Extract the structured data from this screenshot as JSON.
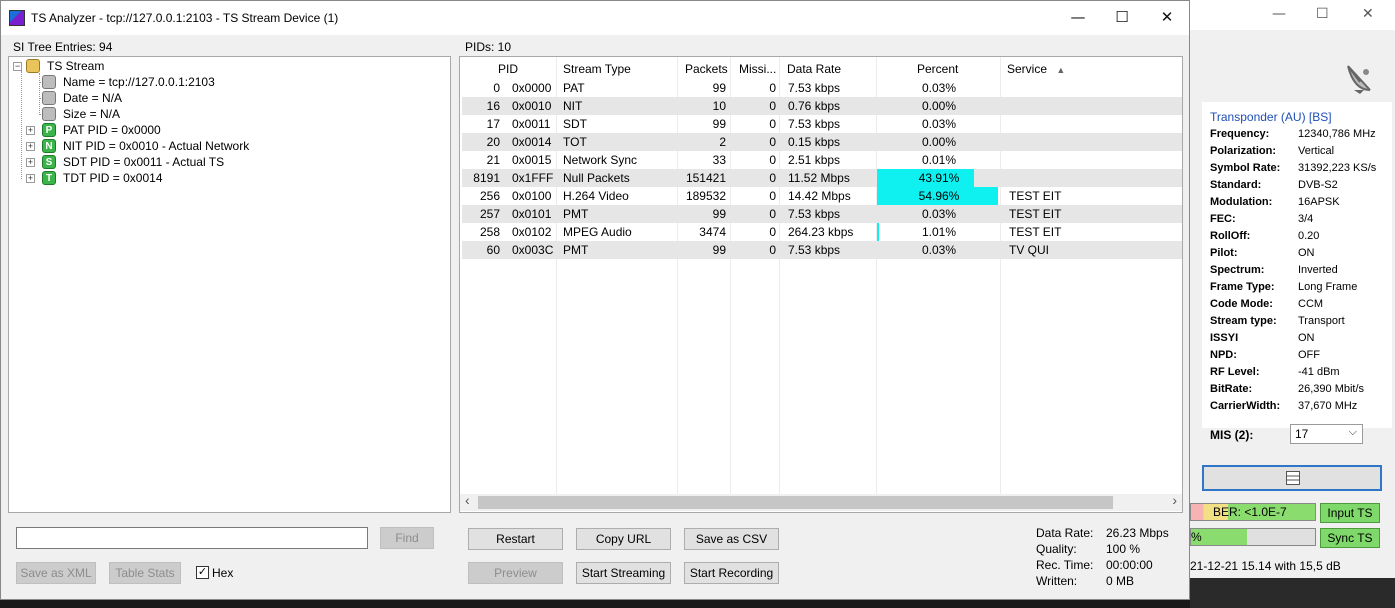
{
  "window": {
    "title": "TS Analyzer - tcp://127.0.0.1:2103 - TS Stream Device (1)",
    "minimize": "—",
    "maximize": "☐",
    "close": "✕"
  },
  "si_tree": {
    "header": "SI Tree Entries: 94",
    "root": "TS Stream",
    "items": [
      {
        "label": "Name = tcp://127.0.0.1:2103",
        "icon": "leaf-icon",
        "badge": ""
      },
      {
        "label": "Date = N/A",
        "icon": "leaf-icon",
        "badge": ""
      },
      {
        "label": "Size = N/A",
        "icon": "leaf-icon",
        "badge": ""
      },
      {
        "label": "PAT PID = 0x0000",
        "icon": "pat-table-icon",
        "badge": "P"
      },
      {
        "label": "NIT PID = 0x0010 - Actual Network",
        "icon": "nit-table-icon",
        "badge": "N"
      },
      {
        "label": "SDT PID = 0x0011 - Actual TS",
        "icon": "sdt-table-icon",
        "badge": "S"
      },
      {
        "label": "TDT PID = 0x0014",
        "icon": "tdt-table-icon",
        "badge": "T"
      }
    ]
  },
  "find": {
    "value": "",
    "button": "Find",
    "save_xml": "Save as XML",
    "table_stats": "Table Stats",
    "hex_label": "Hex",
    "hex_check": "✓"
  },
  "pids": {
    "header": "PIDs: 10",
    "columns": {
      "pid": "PID",
      "stream_type": "Stream Type",
      "packets": "Packets",
      "missing": "Missi...",
      "data_rate": "Data Rate",
      "percent": "Percent",
      "service": "Service",
      "sort_indicator": "▲"
    },
    "rows": [
      {
        "pid": "0",
        "hex": "0x0000",
        "type": "PAT",
        "packets": "99",
        "missing": "0",
        "rate": "7.53 kbps",
        "percent": "0.03%",
        "bar": 0.0003,
        "service": ""
      },
      {
        "pid": "16",
        "hex": "0x0010",
        "type": "NIT",
        "packets": "10",
        "missing": "0",
        "rate": "0.76 kbps",
        "percent": "0.00%",
        "bar": 0,
        "service": ""
      },
      {
        "pid": "17",
        "hex": "0x0011",
        "type": "SDT",
        "packets": "99",
        "missing": "0",
        "rate": "7.53 kbps",
        "percent": "0.03%",
        "bar": 0.0003,
        "service": ""
      },
      {
        "pid": "20",
        "hex": "0x0014",
        "type": "TOT",
        "packets": "2",
        "missing": "0",
        "rate": "0.15 kbps",
        "percent": "0.00%",
        "bar": 0,
        "service": ""
      },
      {
        "pid": "21",
        "hex": "0x0015",
        "type": "Network Sync",
        "packets": "33",
        "missing": "0",
        "rate": "2.51 kbps",
        "percent": "0.01%",
        "bar": 0.0001,
        "service": ""
      },
      {
        "pid": "8191",
        "hex": "0x1FFF",
        "type": "Null Packets",
        "packets": "151421",
        "missing": "0",
        "rate": "11.52 Mbps",
        "percent": "43.91%",
        "bar": 0.4391,
        "service": ""
      },
      {
        "pid": "256",
        "hex": "0x0100",
        "type": "H.264 Video",
        "packets": "189532",
        "missing": "0",
        "rate": "14.42 Mbps",
        "percent": "54.96%",
        "bar": 0.5496,
        "service": "TEST EIT"
      },
      {
        "pid": "257",
        "hex": "0x0101",
        "type": "PMT",
        "packets": "99",
        "missing": "0",
        "rate": "7.53 kbps",
        "percent": "0.03%",
        "bar": 0.0003,
        "service": "TEST EIT"
      },
      {
        "pid": "258",
        "hex": "0x0102",
        "type": "MPEG Audio",
        "packets": "3474",
        "missing": "0",
        "rate": "264.23 kbps",
        "percent": "1.01%",
        "bar": 0.0101,
        "service": "TEST EIT"
      },
      {
        "pid": "60",
        "hex": "0x003C",
        "type": "PMT",
        "packets": "99",
        "missing": "0",
        "rate": "7.53 kbps",
        "percent": "0.03%",
        "bar": 0.0003,
        "service": "TV QUI"
      }
    ],
    "scroll_left": "‹",
    "scroll_right": "›"
  },
  "buttons": {
    "restart": "Restart",
    "copy_url": "Copy URL",
    "save_csv": "Save as CSV",
    "preview": "Preview",
    "start_streaming": "Start Streaming",
    "start_recording": "Start Recording"
  },
  "stats": {
    "data_rate_label": "Data Rate:",
    "data_rate": "26.23 Mbps",
    "quality_label": "Quality:",
    "quality": "100 %",
    "rec_time_label": "Rec. Time:",
    "rec_time": "00:00:00",
    "written_label": "Written:",
    "written": "0 MB"
  },
  "bg_window": {
    "minimize": "—",
    "maximize": "☐",
    "close": "✕",
    "header": "Transponder (AU) [BS]",
    "rows": [
      {
        "k": "Frequency:",
        "v": "12340,786 MHz"
      },
      {
        "k": "Polarization:",
        "v": "Vertical"
      },
      {
        "k": "Symbol Rate:",
        "v": "31392,223 KS/s"
      },
      {
        "k": "Standard:",
        "v": "DVB-S2"
      },
      {
        "k": "Modulation:",
        "v": "16APSK"
      },
      {
        "k": "FEC:",
        "v": "3/4"
      },
      {
        "k": "RollOff:",
        "v": "0.20"
      },
      {
        "k": "Pilot:",
        "v": "ON"
      },
      {
        "k": "Spectrum:",
        "v": "Inverted"
      },
      {
        "k": "Frame Type:",
        "v": "Long Frame"
      },
      {
        "k": "Code Mode:",
        "v": "CCM"
      },
      {
        "k": "Stream type:",
        "v": "Transport"
      },
      {
        "k": "ISSYI",
        "v": "ON"
      },
      {
        "k": "NPD:",
        "v": "OFF"
      },
      {
        "k": "RF Level:",
        "v": "-41 dBm"
      },
      {
        "k": "BitRate:",
        "v": "26,390 Mbit/s"
      },
      {
        "k": "CarrierWidth:",
        "v": "37,670 MHz"
      }
    ],
    "mis_label": "MIS (2):",
    "mis_value": "17",
    "ber": "BER: <1.0E-7",
    "pct": "%",
    "input_ts": "Input TS",
    "sync_ts": "Sync TS",
    "status": "21-12-21 15.14 with 15,5 dB"
  },
  "colors": {
    "percent_bar": "#0ff0f0",
    "transponder_header": "#1f4fb4"
  }
}
